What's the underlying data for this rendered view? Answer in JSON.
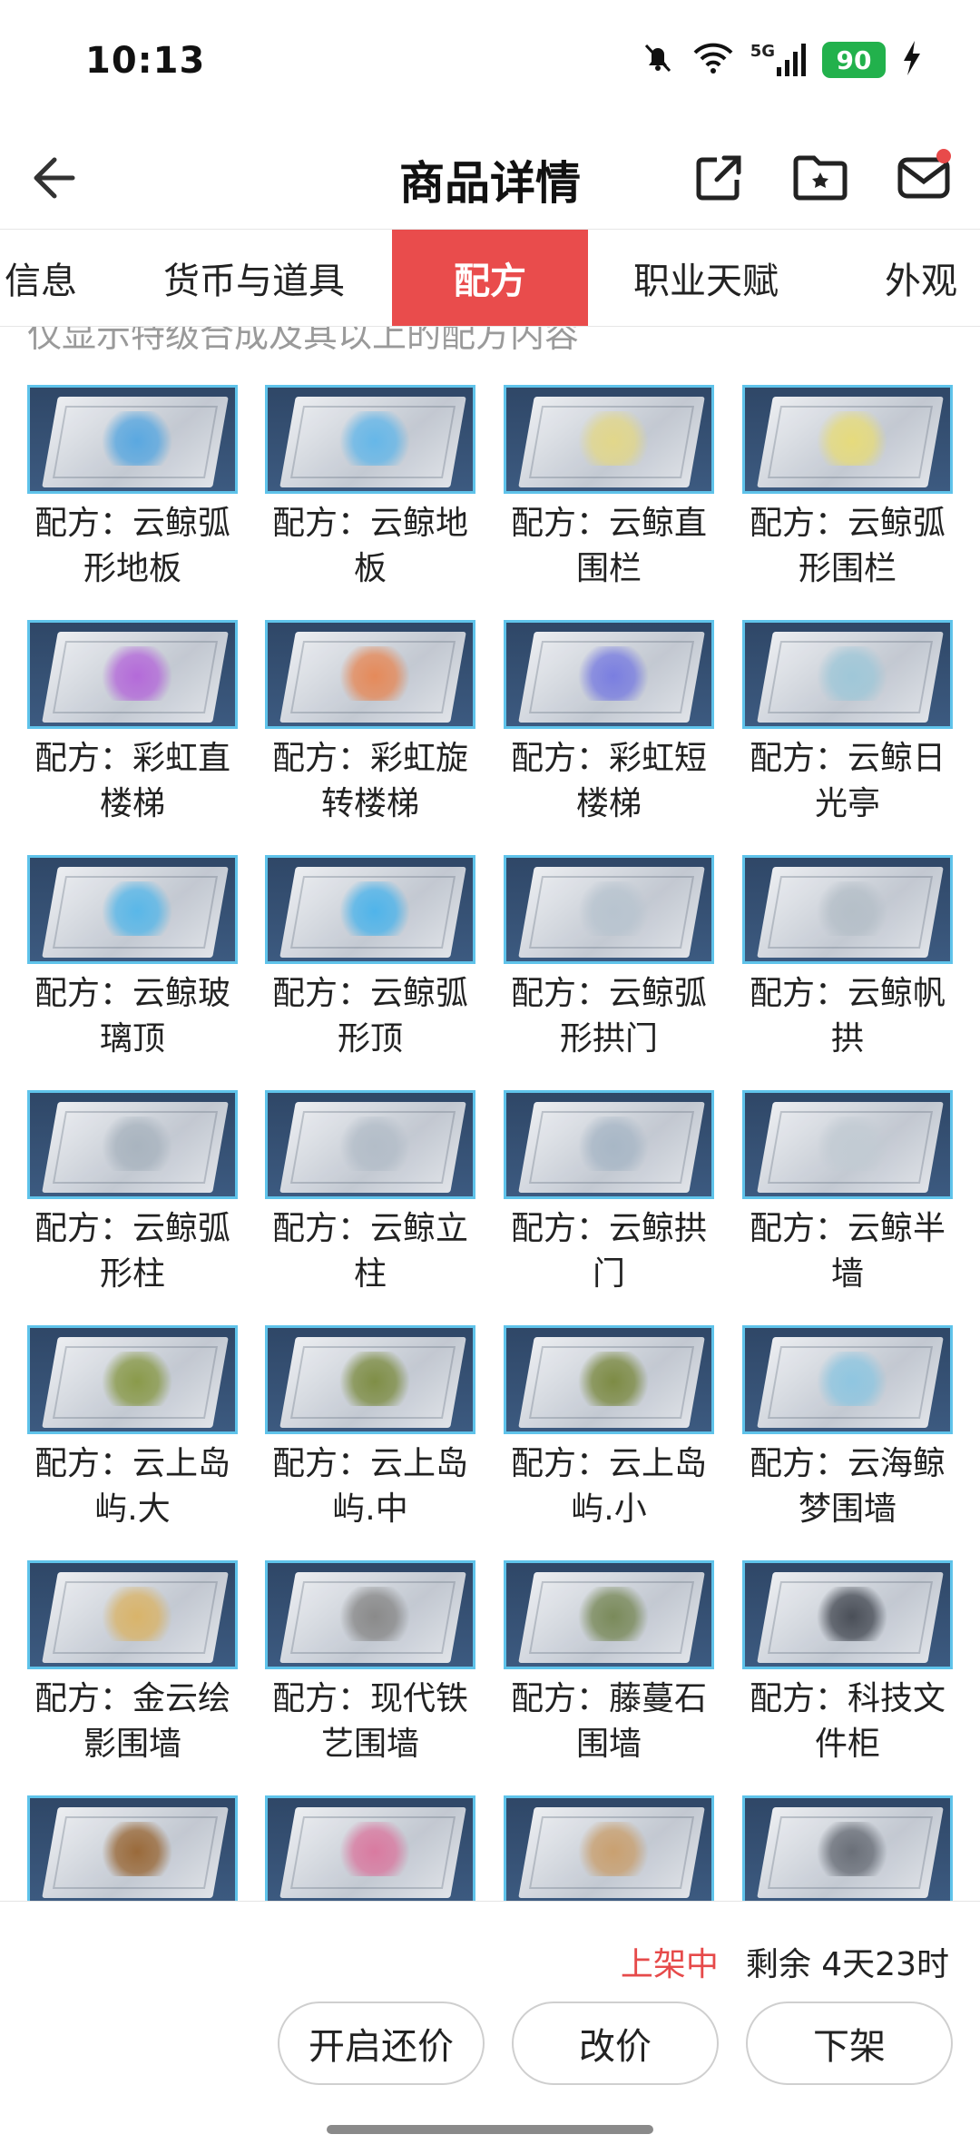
{
  "status_bar": {
    "time": "10:13",
    "network": "5G",
    "battery": "90",
    "icons": [
      "mute-bell-icon",
      "wifi-icon",
      "signal-icon",
      "battery-icon",
      "charging-icon"
    ]
  },
  "header": {
    "title": "商品详情",
    "icons": [
      "back-arrow-icon",
      "share-icon",
      "favorite-folder-icon",
      "message-icon"
    ]
  },
  "tabs": [
    {
      "label": "信息",
      "active": false
    },
    {
      "label": "货币与道具",
      "active": false
    },
    {
      "label": "配方",
      "active": true
    },
    {
      "label": "职业天赋",
      "active": false
    },
    {
      "label": "外观",
      "active": false
    }
  ],
  "notice": "仅显示特级合成及其以上的配方内容",
  "recipes": [
    {
      "line1": "配方：云鲸弧",
      "line2": "形地板",
      "accent": "#5aa8e0"
    },
    {
      "line1": "配方：云鲸地",
      "line2": "板",
      "accent": "#66b7e8"
    },
    {
      "line1": "配方：云鲸直",
      "line2": "围栏",
      "accent": "#e2d78a"
    },
    {
      "line1": "配方：云鲸弧",
      "line2": "形围栏",
      "accent": "#e6db7c"
    },
    {
      "line1": "配方：彩虹直",
      "line2": "楼梯",
      "accent": "#b46ad9"
    },
    {
      "line1": "配方：彩虹旋",
      "line2": "转楼梯",
      "accent": "#e58a5a"
    },
    {
      "line1": "配方：彩虹短",
      "line2": "楼梯",
      "accent": "#7a7ee0"
    },
    {
      "line1": "配方：云鲸日",
      "line2": "光亭",
      "accent": "#9fc7d8"
    },
    {
      "line1": "配方：云鲸玻",
      "line2": "璃顶",
      "accent": "#59b7e8"
    },
    {
      "line1": "配方：云鲸弧",
      "line2": "形顶",
      "accent": "#4fb4ea"
    },
    {
      "line1": "配方：云鲸弧",
      "line2": "形拱门",
      "accent": "#b8c4cf"
    },
    {
      "line1": "配方：云鲸帆",
      "line2": "拱",
      "accent": "#b5bfc8"
    },
    {
      "line1": "配方：云鲸弧",
      "line2": "形柱",
      "accent": "#a9b4bf"
    },
    {
      "line1": "配方：云鲸立",
      "line2": "柱",
      "accent": "#b3bdc8"
    },
    {
      "line1": "配方：云鲸拱",
      "line2": "门",
      "accent": "#a8b7c6"
    },
    {
      "line1": "配方：云鲸半",
      "line2": "墙",
      "accent": "#c2cbd3"
    },
    {
      "line1": "配方：云上岛",
      "line2": "屿.大",
      "accent": "#8a9a4a"
    },
    {
      "line1": "配方：云上岛",
      "line2": "屿.中",
      "accent": "#7f8e46"
    },
    {
      "line1": "配方：云上岛",
      "line2": "屿.小",
      "accent": "#7d8b44"
    },
    {
      "line1": "配方：云海鲸",
      "line2": "梦围墙",
      "accent": "#8fc6e0"
    },
    {
      "line1": "配方：金云绘",
      "line2": "影围墙",
      "accent": "#d9b46a"
    },
    {
      "line1": "配方：现代铁",
      "line2": "艺围墙",
      "accent": "#8a8a8a"
    },
    {
      "line1": "配方：藤蔓石",
      "line2": "围墙",
      "accent": "#7a8a5a"
    },
    {
      "line1": "配方：科技文",
      "line2": "件柜",
      "accent": "#4a4f58"
    },
    {
      "line1": "",
      "line2": "",
      "accent": "#9a6a3a"
    },
    {
      "line1": "",
      "line2": "",
      "accent": "#d97aa0"
    },
    {
      "line1": "",
      "line2": "",
      "accent": "#c9a070"
    },
    {
      "line1": "",
      "line2": "",
      "accent": "#6a6f78"
    }
  ],
  "bottom": {
    "status_label": "上架中",
    "remaining": "剩余 4天23时",
    "buttons": [
      "开启还价",
      "改价",
      "下架"
    ]
  }
}
